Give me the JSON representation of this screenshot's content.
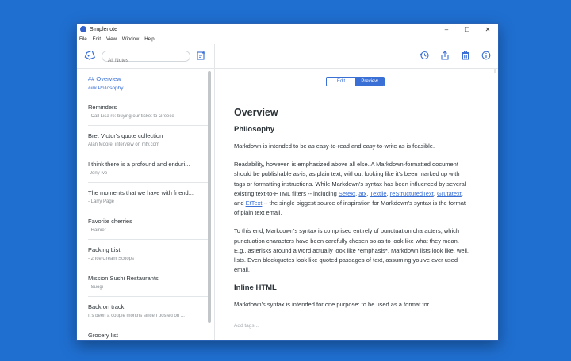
{
  "window": {
    "title": "Simplenote",
    "controls": {
      "minimize": "–",
      "maximize": "☐",
      "close": "✕"
    }
  },
  "menubar": {
    "items": [
      "File",
      "Edit",
      "View",
      "Window",
      "Help"
    ]
  },
  "toolbar": {
    "search_placeholder": "All Notes",
    "icons": [
      "tag-icon",
      "new-note-icon",
      "history-icon",
      "share-icon",
      "trash-icon",
      "info-icon"
    ]
  },
  "notes": [
    {
      "title": "## Overview",
      "subtitle": "### Philosophy"
    },
    {
      "title": "Reminders",
      "subtitle": "- Call Lisa re: buying our ticket to Greece"
    },
    {
      "title": "Bret Victor's quote collection",
      "subtitle": "Alan Moore: interview on mtv.com"
    },
    {
      "title": "I think there is a profound and enduri...",
      "subtitle": "-Jony Ive"
    },
    {
      "title": "The moments that we have with friend...",
      "subtitle": "- Larry Page"
    },
    {
      "title": "Favorite cherries",
      "subtitle": "- Rainier"
    },
    {
      "title": "Packing List",
      "subtitle": "- 2 Ice Cream Scoops"
    },
    {
      "title": "Mission Sushi Restaurants",
      "subtitle": "- Suogi"
    },
    {
      "title": "Back on track",
      "subtitle": "It's been a couple months since I posted on ..."
    },
    {
      "title": "Grocery list",
      "subtitle": ""
    }
  ],
  "editor": {
    "mode_edit": "Edit",
    "mode_preview": "Preview",
    "heading1": "Overview",
    "heading2": "Philosophy",
    "p1": "Markdown is intended to be as easy-to-read and easy-to-write as is feasible.",
    "p2_a": "Readability, however, is emphasized above all else. A Markdown-formatted document should be publishable as-is, as plain text, without looking like it's been marked up with tags or formatting instructions. While Markdown's syntax has been influenced by several existing text-to-HTML filters -- including ",
    "link_setext": "Setext",
    "sep1": ", ",
    "link_atx": "atx",
    "sep2": ", ",
    "link_textile": "Textile",
    "sep3": ", ",
    "link_rst": "reStructuredText",
    "sep4": ", ",
    "link_grutatext": "Grutatext",
    "sep5": ", and ",
    "link_ettext": "EtText",
    "p2_b": " -- the single biggest source of inspiration for Markdown's syntax is the format of plain text email.",
    "p3": "To this end, Markdown's syntax is comprised entirely of punctuation characters, which punctuation characters have been carefully chosen so as to look like what they mean. E.g., asterisks around a word actually look like *emphasis*. Markdown lists look like, well, lists. Even blockquotes look like quoted passages of text, assuming you've ever used email.",
    "heading3": "Inline HTML",
    "p4": "Markdown's syntax is intended for one purpose: to be used as a format for",
    "tags_placeholder": "Add tags..."
  },
  "colors": {
    "accent": "#3a6fd6",
    "desktop": "#1f6fd1",
    "text": "#2c3338",
    "muted": "#868c90"
  }
}
